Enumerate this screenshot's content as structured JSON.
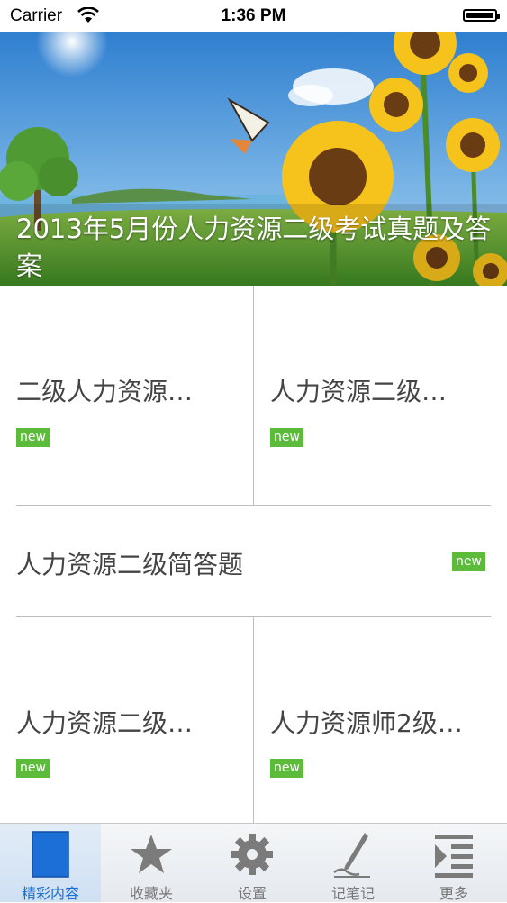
{
  "status_bar": {
    "carrier": "Carrier",
    "time": "1:36 PM"
  },
  "hero": {
    "title": "2013年5月份人力资源二级考试真题及答案"
  },
  "tiles": [
    {
      "title": "二级人力资源…",
      "badge": "new"
    },
    {
      "title": "人力资源二级…",
      "badge": "new"
    },
    {
      "title": "人力资源二级简答题",
      "badge": "new"
    },
    {
      "title": "人力资源二级…",
      "badge": "new"
    },
    {
      "title": "人力资源师2级…",
      "badge": "new"
    }
  ],
  "tabbar": {
    "items": [
      {
        "label": "精彩内容",
        "icon": "content-icon"
      },
      {
        "label": "收藏夹",
        "icon": "star-icon"
      },
      {
        "label": "设置",
        "icon": "gear-icon"
      },
      {
        "label": "记笔记",
        "icon": "pen-icon"
      },
      {
        "label": "更多",
        "icon": "more-list-icon"
      }
    ],
    "active_index": 0
  },
  "colors": {
    "badge": "#5dbb3b",
    "active_tab": "#1a6fd1"
  }
}
